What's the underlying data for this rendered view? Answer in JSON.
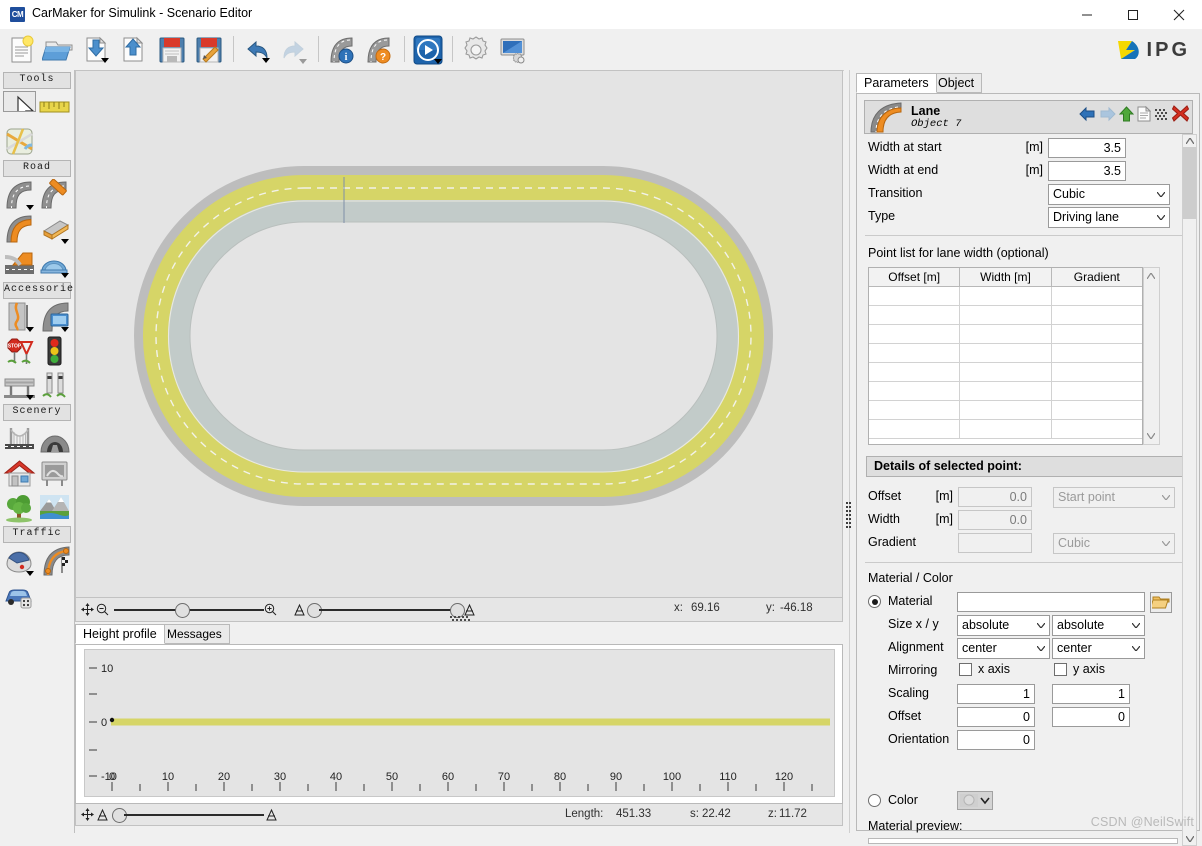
{
  "window": {
    "app_icon": "CM",
    "title": "CarMaker for Simulink - Scenario Editor",
    "minimize": "minimize-icon",
    "maximize": "maximize-icon",
    "close": "close-icon"
  },
  "brand": {
    "logo": "ipg-logo-icon",
    "text": "IPG"
  },
  "toolbar": {
    "buttons": [
      {
        "name": "new-file-icon",
        "tip": "New"
      },
      {
        "name": "open-folder-icon",
        "tip": "Open"
      },
      {
        "name": "import-file-icon",
        "tip": "Import"
      },
      {
        "name": "export-file-icon",
        "tip": "Export"
      },
      {
        "name": "save-icon",
        "tip": "Save"
      },
      {
        "name": "save-as-icon",
        "tip": "Save as"
      },
      {
        "name": "undo-icon",
        "tip": "Undo"
      },
      {
        "name": "redo-icon",
        "tip": "Redo"
      },
      {
        "name": "road-info-icon",
        "tip": "Road info"
      },
      {
        "name": "road-help-icon",
        "tip": "Road help"
      },
      {
        "name": "run-play-icon",
        "tip": "Run"
      },
      {
        "name": "settings-gear-icon",
        "tip": "Settings"
      },
      {
        "name": "display-settings-icon",
        "tip": "Display settings"
      }
    ]
  },
  "palette": {
    "groups": [
      {
        "title": "Tools",
        "items": [
          {
            "name": "select-arrow-tool",
            "selected": true
          },
          {
            "name": "ruler-measure-tool",
            "selected": false
          },
          {
            "name": "map-overview-tool",
            "selected": false
          }
        ]
      },
      {
        "title": "Road",
        "items": [
          {
            "name": "road-segment-tool",
            "dropdown": true
          },
          {
            "name": "road-junction-tool",
            "dropdown": false
          },
          {
            "name": "road-lane-tool",
            "dropdown": false
          },
          {
            "name": "road-bridge-profile-tool",
            "dropdown": true
          },
          {
            "name": "road-ramp-tool",
            "dropdown": false
          },
          {
            "name": "road-tunnel-tool",
            "dropdown": true
          }
        ]
      },
      {
        "title": "Accessories",
        "items": [
          {
            "name": "lane-marking-tool",
            "dropdown": true
          },
          {
            "name": "billboard-sign-tool",
            "dropdown": true
          },
          {
            "name": "traffic-sign-tool",
            "dropdown": false
          },
          {
            "name": "traffic-light-tool",
            "dropdown": false
          },
          {
            "name": "guardrail-tool",
            "dropdown": true
          },
          {
            "name": "road-post-tool",
            "dropdown": false
          }
        ]
      },
      {
        "title": "Scenery",
        "items": [
          {
            "name": "bridge-tool",
            "dropdown": false
          },
          {
            "name": "tunnel-tool",
            "dropdown": false
          },
          {
            "name": "building-house-tool",
            "dropdown": false
          },
          {
            "name": "billboard-tool",
            "dropdown": false
          },
          {
            "name": "tree-tool",
            "dropdown": false
          },
          {
            "name": "landscape-tool",
            "dropdown": false
          }
        ]
      },
      {
        "title": "Traffic",
        "items": [
          {
            "name": "driver-helmet-tool",
            "dropdown": true
          },
          {
            "name": "route-racing-tool",
            "dropdown": false
          },
          {
            "name": "traffic-vehicle-tool",
            "dropdown": false
          }
        ]
      }
    ]
  },
  "canvas": {
    "status": {
      "x_label": "x:",
      "x_value": "69.16",
      "y_label": "y:",
      "y_value": "-46.18"
    },
    "zoom_out_icon": "zoom-out-icon",
    "zoom_in_icon": "zoom-in-icon",
    "pan_icon": "pan-move-icon",
    "track": {
      "description": "Closed oval test track, two lanes",
      "lanes": [
        {
          "name": "outer-lane",
          "color": "#d6d567"
        },
        {
          "name": "inner-lane",
          "color": "#c2cbc9"
        }
      ],
      "border_color": "#b9b9b9",
      "background": "#e4e4e4"
    }
  },
  "bottom": {
    "tabs": [
      {
        "label": "Height profile",
        "active": true
      },
      {
        "label": "Messages",
        "active": false
      }
    ],
    "height_profile": {
      "y_ticks": [
        "10",
        "0",
        "-10"
      ],
      "x_ticks": [
        "0",
        "10",
        "20",
        "30",
        "40",
        "50",
        "60",
        "70",
        "80",
        "90",
        "100",
        "110",
        "120"
      ],
      "line_color": "#d6d567",
      "x_min": 0,
      "x_max": 126,
      "y_min": -10,
      "y_max": 10,
      "series_value": 0
    },
    "status": {
      "length_label": "Length:",
      "length_value": "451.33",
      "s_label": "s:",
      "s_value": "22.42",
      "z_label": "z:",
      "z_value": "11.72"
    }
  },
  "right_panel": {
    "tabs": [
      {
        "label": "Parameters",
        "active": true
      },
      {
        "label": "Object List",
        "active": false
      }
    ],
    "object": {
      "icon": "road-curve-icon",
      "title": "Lane",
      "subtitle": "Object 7",
      "actions": [
        {
          "name": "previous-object-icon"
        },
        {
          "name": "next-object-icon"
        },
        {
          "name": "move-up-icon"
        },
        {
          "name": "new-object-icon"
        },
        {
          "name": "copy-object-icon"
        },
        {
          "name": "delete-object-icon"
        }
      ]
    },
    "params": {
      "width_start": {
        "label": "Width at start",
        "unit": "[m]",
        "value": "3.5"
      },
      "width_end": {
        "label": "Width at end",
        "unit": "[m]",
        "value": "3.5"
      },
      "transition": {
        "label": "Transition",
        "value": "Cubic"
      },
      "type": {
        "label": "Type",
        "value": "Driving lane"
      }
    },
    "point_list": {
      "title": "Point list for lane width (optional)",
      "columns": [
        "Offset [m]",
        "Width [m]",
        "Gradient"
      ],
      "rows": [
        [
          "",
          "",
          ""
        ],
        [
          "",
          "",
          ""
        ],
        [
          "",
          "",
          ""
        ],
        [
          "",
          "",
          ""
        ],
        [
          "",
          "",
          ""
        ],
        [
          "",
          "",
          ""
        ],
        [
          "",
          "",
          ""
        ],
        [
          "",
          "",
          ""
        ]
      ]
    },
    "details": {
      "title": "Details of selected point:",
      "offset": {
        "label": "Offset",
        "unit": "[m]",
        "value": "0.0",
        "mode": "Start point"
      },
      "width": {
        "label": "Width",
        "unit": "[m]",
        "value": "0.0"
      },
      "gradient": {
        "label": "Gradient",
        "value": "",
        "mode": "Cubic"
      }
    },
    "material": {
      "section_title": "Material / Color",
      "material_radio": {
        "label": "Material",
        "selected": true
      },
      "material_value": "",
      "browse_icon": "open-folder-icon",
      "size_label": "Size x / y",
      "size_x": "absolute",
      "size_y": "absolute",
      "alignment_label": "Alignment",
      "alignment_x": "center",
      "alignment_y": "center",
      "mirroring_label": "Mirroring",
      "mirror_x": "x axis",
      "mirror_y": "y axis",
      "mirror_x_checked": false,
      "mirror_y_checked": false,
      "scaling_label": "Scaling",
      "scaling_x": "1",
      "scaling_y": "1",
      "offset_label": "Offset",
      "offset_x": "0",
      "offset_y": "0",
      "orientation_label": "Orientation",
      "orientation": "0",
      "color_radio": {
        "label": "Color",
        "selected": false
      },
      "preview_label": "Material preview:"
    }
  },
  "watermark": "CSDN @NeilSwift"
}
